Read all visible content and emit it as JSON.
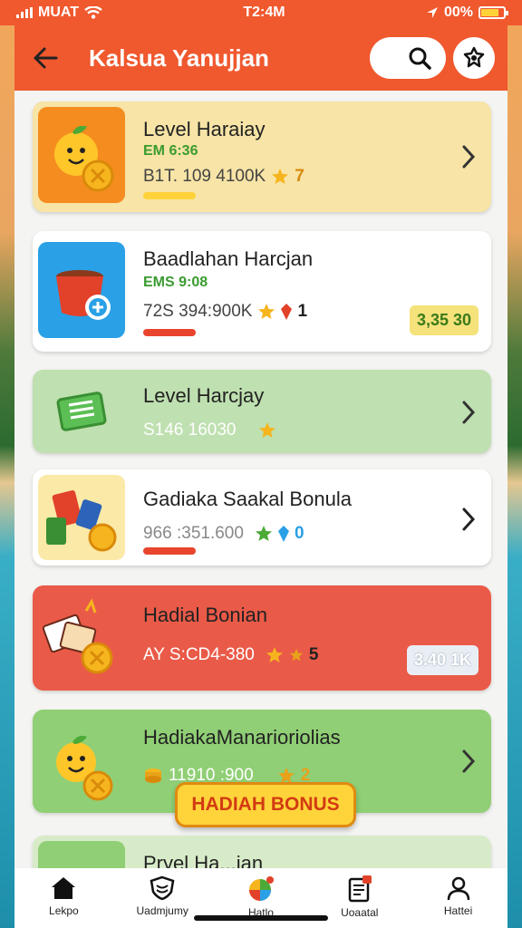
{
  "status_bar": {
    "carrier": "MUAT",
    "time": "T2:4M",
    "battery": "00%"
  },
  "header": {
    "title": "Kalsua Yanujjan"
  },
  "cards": [
    {
      "title": "Level Haraiay",
      "subtitle": "EM 6:36",
      "meta": "B1T. 109 4100K",
      "meta_extra": "7",
      "progress_color": "#ffd23a",
      "bg": "#f7e4a6",
      "thumb_bg": "#f58c1f",
      "thumb_icon": "orange-mascot-icon",
      "action": "chevron"
    },
    {
      "title": "Baadlahan Harcjan",
      "subtitle": "EMS 9:08",
      "meta": "72S 394:900K",
      "meta_extra": "1",
      "badge": "3,35 30",
      "progress_color": "#e8452c",
      "bg": "#ffffff",
      "thumb_bg": "#2aa0e6",
      "thumb_icon": "basket-icon"
    },
    {
      "title": "Level Harcjay",
      "meta": "S146 16030",
      "bg": "#bfe0b0",
      "thumb_icon": "ticket-icon",
      "action": "chevron"
    },
    {
      "title": "Gadiaka Saakal Bonula",
      "meta": "966 :351.600",
      "meta_extra": "0",
      "progress_color": "#e8452c",
      "bg": "#ffffff",
      "thumb_bg": "#fbe9a8",
      "thumb_icon": "cans-icon",
      "action": "chevron"
    },
    {
      "title": "Hadial Bonian",
      "meta": "AY S:CD4-380",
      "meta_extra": "5",
      "badge": "3.40 1K",
      "bg": "#ea5a48",
      "thumb_icon": "cards-coin-icon"
    },
    {
      "title": "HadiakaManarioriolias",
      "meta": "11910 :900",
      "meta_extra": "2",
      "bg": "#90cf75",
      "thumb_icon": "orange-mascot-icon",
      "action": "chevron"
    },
    {
      "title": "Pryel Ha...jan",
      "bg": "#d7ebc8"
    }
  ],
  "bonus_banner": "HADIAH BONUS",
  "bottom_nav": [
    {
      "label": "Lekpo",
      "icon": "home-icon"
    },
    {
      "label": "Uadmjumy",
      "icon": "shield-heart-icon"
    },
    {
      "label": "Hatlo",
      "icon": "wheel-icon"
    },
    {
      "label": "Uoaatal",
      "icon": "clipboard-icon"
    },
    {
      "label": "Hattei",
      "icon": "user-icon"
    }
  ],
  "colors": {
    "brand": "#f0582e",
    "star": "#f6b51e",
    "chevron": "#333333"
  }
}
